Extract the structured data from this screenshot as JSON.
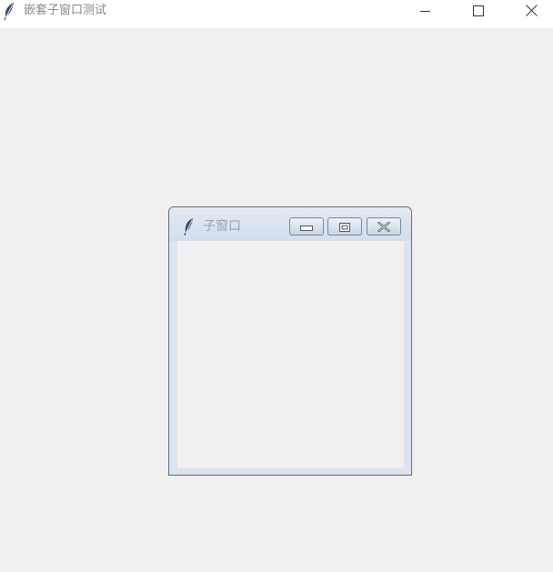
{
  "window": {
    "title": "嵌套子窗口测试",
    "icon": "feather-icon",
    "controls": [
      "minimize-icon",
      "maximize-icon",
      "close-icon"
    ]
  },
  "child_window": {
    "title": "子窗口",
    "icon": "feather-icon",
    "controls": [
      "minimize-icon",
      "restore-icon",
      "close-icon"
    ]
  },
  "colors": {
    "background": "#f0f0f0",
    "titlebar": "#ffffff",
    "child_frame": "#dbe4f0",
    "title_text": "#8a8a8a"
  }
}
